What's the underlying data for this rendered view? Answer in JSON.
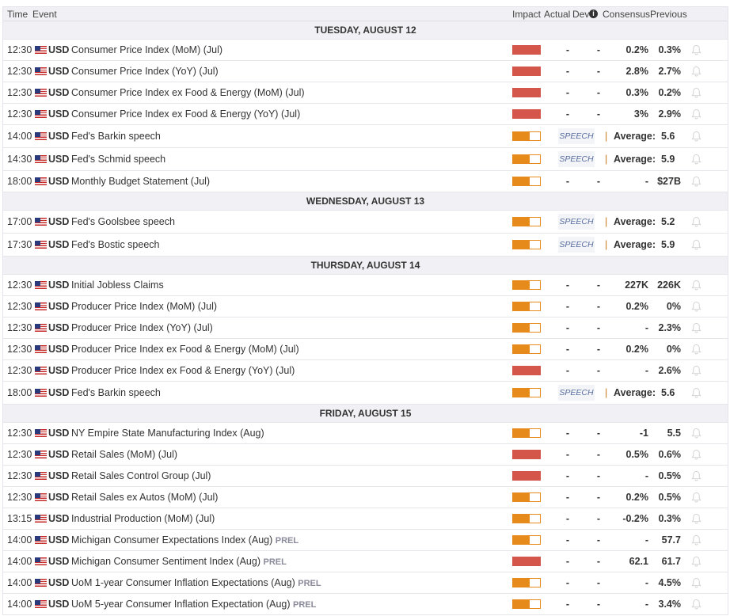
{
  "header": {
    "time": "Time",
    "event": "Event",
    "impact": "Impact",
    "actual": "Actual",
    "dev": "Dev",
    "info": "i",
    "consensus": "Consensus",
    "previous": "Previous"
  },
  "speech_label": "SPEECH",
  "average_label": "Average:",
  "colors": {
    "high": "#d4564a",
    "medium": "#e68a1c"
  },
  "days": [
    {
      "date": "TUESDAY, AUGUST 12",
      "events": [
        {
          "time": "12:30",
          "currency": "USD",
          "name": "Consumer Price Index (MoM) (Jul)",
          "impact": "high",
          "actual": "-",
          "dev": "-",
          "consensus": "0.2%",
          "previous": "0.3%"
        },
        {
          "time": "12:30",
          "currency": "USD",
          "name": "Consumer Price Index (YoY) (Jul)",
          "impact": "high",
          "actual": "-",
          "dev": "-",
          "consensus": "2.8%",
          "previous": "2.7%"
        },
        {
          "time": "12:30",
          "currency": "USD",
          "name": "Consumer Price Index ex Food & Energy (MoM) (Jul)",
          "impact": "high",
          "actual": "-",
          "dev": "-",
          "consensus": "0.3%",
          "previous": "0.2%"
        },
        {
          "time": "12:30",
          "currency": "USD",
          "name": "Consumer Price Index ex Food & Energy (YoY) (Jul)",
          "impact": "high",
          "actual": "-",
          "dev": "-",
          "consensus": "3%",
          "previous": "2.9%"
        },
        {
          "time": "14:00",
          "currency": "USD",
          "name": "Fed's Barkin speech",
          "impact": "medium",
          "speech": true,
          "average": "5.6"
        },
        {
          "time": "14:30",
          "currency": "USD",
          "name": "Fed's Schmid speech",
          "impact": "medium",
          "speech": true,
          "average": "5.9"
        },
        {
          "time": "18:00",
          "currency": "USD",
          "name": "Monthly Budget Statement (Jul)",
          "impact": "medium",
          "actual": "-",
          "dev": "-",
          "consensus": "-",
          "previous": "$27B"
        }
      ]
    },
    {
      "date": "WEDNESDAY, AUGUST 13",
      "events": [
        {
          "time": "17:00",
          "currency": "USD",
          "name": "Fed's Goolsbee speech",
          "impact": "medium",
          "speech": true,
          "average": "5.2"
        },
        {
          "time": "17:30",
          "currency": "USD",
          "name": "Fed's Bostic speech",
          "impact": "medium",
          "speech": true,
          "average": "5.9"
        }
      ]
    },
    {
      "date": "THURSDAY, AUGUST 14",
      "events": [
        {
          "time": "12:30",
          "currency": "USD",
          "name": "Initial Jobless Claims",
          "impact": "medium",
          "actual": "-",
          "dev": "-",
          "consensus": "227K",
          "previous": "226K"
        },
        {
          "time": "12:30",
          "currency": "USD",
          "name": "Producer Price Index (MoM) (Jul)",
          "impact": "medium",
          "actual": "-",
          "dev": "-",
          "consensus": "0.2%",
          "previous": "0%"
        },
        {
          "time": "12:30",
          "currency": "USD",
          "name": "Producer Price Index (YoY) (Jul)",
          "impact": "medium",
          "actual": "-",
          "dev": "-",
          "consensus": "-",
          "previous": "2.3%"
        },
        {
          "time": "12:30",
          "currency": "USD",
          "name": "Producer Price Index ex Food & Energy (MoM) (Jul)",
          "impact": "medium",
          "actual": "-",
          "dev": "-",
          "consensus": "0.2%",
          "previous": "0%"
        },
        {
          "time": "12:30",
          "currency": "USD",
          "name": "Producer Price Index ex Food & Energy (YoY) (Jul)",
          "impact": "high",
          "actual": "-",
          "dev": "-",
          "consensus": "-",
          "previous": "2.6%"
        },
        {
          "time": "18:00",
          "currency": "USD",
          "name": "Fed's Barkin speech",
          "impact": "medium",
          "speech": true,
          "average": "5.6"
        }
      ]
    },
    {
      "date": "FRIDAY, AUGUST 15",
      "events": [
        {
          "time": "12:30",
          "currency": "USD",
          "name": "NY Empire State Manufacturing Index (Aug)",
          "impact": "medium",
          "actual": "-",
          "dev": "-",
          "consensus": "-1",
          "previous": "5.5"
        },
        {
          "time": "12:30",
          "currency": "USD",
          "name": "Retail Sales (MoM) (Jul)",
          "impact": "high",
          "actual": "-",
          "dev": "-",
          "consensus": "0.5%",
          "previous": "0.6%"
        },
        {
          "time": "12:30",
          "currency": "USD",
          "name": "Retail Sales Control Group (Jul)",
          "impact": "high",
          "actual": "-",
          "dev": "-",
          "consensus": "-",
          "previous": "0.5%"
        },
        {
          "time": "12:30",
          "currency": "USD",
          "name": "Retail Sales ex Autos (MoM) (Jul)",
          "impact": "medium",
          "actual": "-",
          "dev": "-",
          "consensus": "0.2%",
          "previous": "0.5%"
        },
        {
          "time": "13:15",
          "currency": "USD",
          "name": "Industrial Production (MoM) (Jul)",
          "impact": "medium",
          "actual": "-",
          "dev": "-",
          "consensus": "-0.2%",
          "previous": "0.3%"
        },
        {
          "time": "14:00",
          "currency": "USD",
          "name": "Michigan Consumer Expectations Index (Aug)",
          "tag": "PREL",
          "impact": "medium",
          "actual": "-",
          "dev": "-",
          "consensus": "-",
          "previous": "57.7"
        },
        {
          "time": "14:00",
          "currency": "USD",
          "name": "Michigan Consumer Sentiment Index (Aug)",
          "tag": "PREL",
          "impact": "high",
          "actual": "-",
          "dev": "-",
          "consensus": "62.1",
          "previous": "61.7"
        },
        {
          "time": "14:00",
          "currency": "USD",
          "name": "UoM 1-year Consumer Inflation Expectations (Aug)",
          "tag": "PREL",
          "impact": "medium",
          "actual": "-",
          "dev": "-",
          "consensus": "-",
          "previous": "4.5%"
        },
        {
          "time": "14:00",
          "currency": "USD",
          "name": "UoM 5-year Consumer Inflation Expectation (Aug)",
          "tag": "PREL",
          "impact": "medium",
          "actual": "-",
          "dev": "-",
          "consensus": "-",
          "previous": "3.4%"
        }
      ]
    }
  ]
}
